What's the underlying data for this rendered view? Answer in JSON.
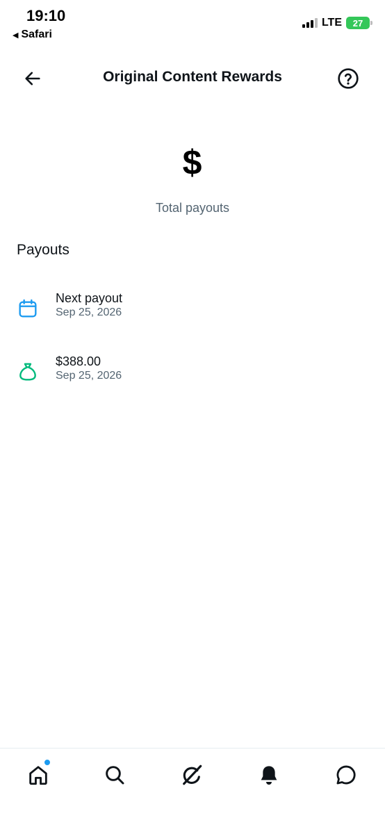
{
  "status_bar": {
    "time": "19:10",
    "back_app": "Safari",
    "network": "LTE",
    "battery": "27"
  },
  "header": {
    "title": "Original Content Rewards",
    "back_icon": "arrow-left-icon",
    "help_icon": "question-circle-icon"
  },
  "summary": {
    "total_amount": "$",
    "total_label": "Total payouts"
  },
  "payouts": {
    "section_title": "Payouts",
    "items": [
      {
        "icon": "calendar-icon",
        "icon_color": "#1d9bf0",
        "title": "Next payout",
        "date": "Sep 25, 2026"
      },
      {
        "icon": "money-bag-icon",
        "icon_color": "#00ba7c",
        "title": "$388.00",
        "date": "Sep 25, 2026"
      }
    ]
  },
  "tab_bar": {
    "items": [
      "home-icon",
      "search-icon",
      "grok-icon",
      "notifications-bell-icon",
      "messages-icon"
    ],
    "active_indicator_color": "#1d9bf0"
  }
}
